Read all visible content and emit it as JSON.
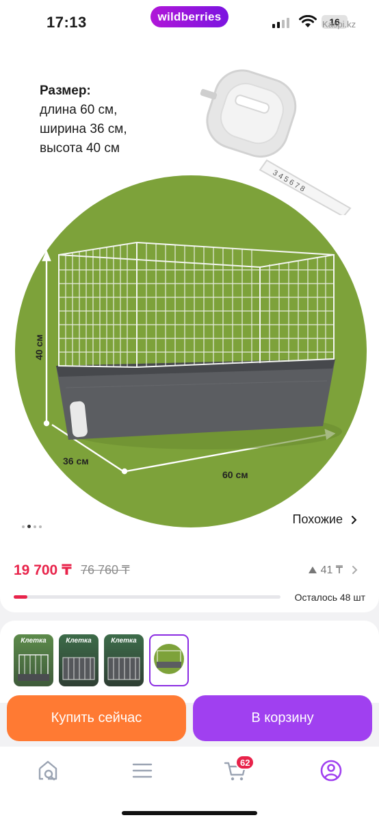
{
  "status_bar": {
    "time": "17:13",
    "brand": "wildberries",
    "battery": "16",
    "watermark": "Kaspi.kz"
  },
  "product_media": {
    "size_title": "Размер:",
    "size_lines": [
      "длина 60 см,",
      "ширина 36 см,",
      "высота 40 см"
    ],
    "dim_height": "40 см",
    "dim_depth": "36 см",
    "dim_length": "60 см",
    "tape_digits": "3 4 5 6 7 8",
    "carousel_pages": 4,
    "carousel_active": 2,
    "similar_label": "Похожие",
    "icons": [
      "back-icon",
      "heart-icon",
      "share-icon",
      "chevron-right-icon"
    ]
  },
  "pricing": {
    "current_price": "19 700 ₸",
    "old_price": "76 760 ₸",
    "rating_count": "41 ₸",
    "stock_label": "Осталось 48 шт",
    "stock_fraction": 0.05
  },
  "thumbnails": [
    {
      "label": "Клетка",
      "selected": false
    },
    {
      "label": "Клетка",
      "selected": false
    },
    {
      "label": "Клетка",
      "selected": false
    },
    {
      "label": "",
      "selected": true
    }
  ],
  "actions": {
    "buy_now": "Купить сейчас",
    "add_to_cart": "В корзину"
  },
  "bottom_nav": {
    "items": [
      "home-search-icon",
      "catalog-icon",
      "cart-icon",
      "profile-icon"
    ],
    "cart_badge": "62",
    "active": "profile-icon"
  },
  "colors": {
    "brand_gradient": [
      "#b016d8",
      "#7b14e0"
    ],
    "price": "#e8234a",
    "buy_button": "#ff7a33",
    "cart_button": "#a040f0",
    "circle": "#7da23a"
  }
}
